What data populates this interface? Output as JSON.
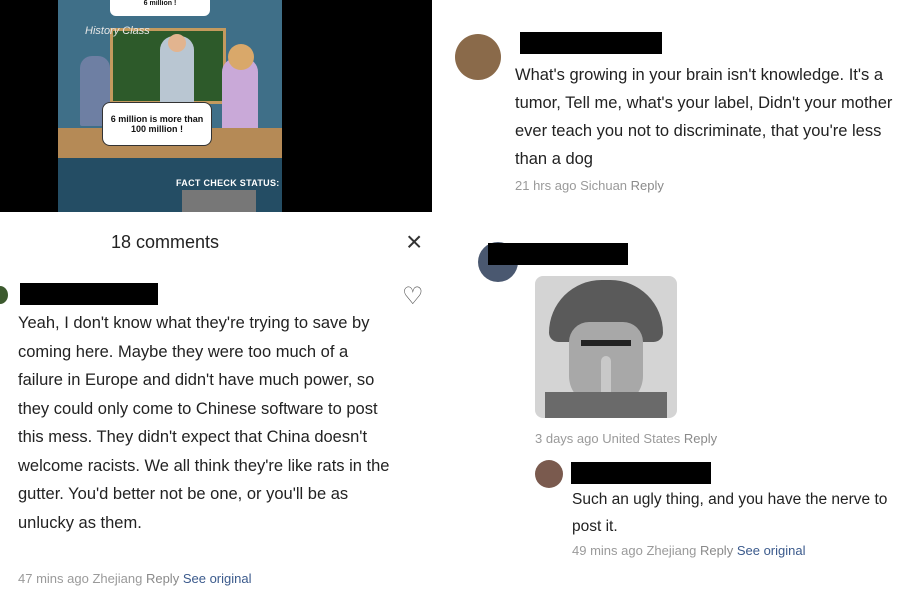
{
  "meme": {
    "top_text": "6 million !",
    "board_label": "History Class",
    "bubble_text": "6 million is more than 100 million !",
    "fact_check": "FACT CHECK STATUS:"
  },
  "left_panel": {
    "comments_title": "18 comments",
    "close_icon": "×",
    "heart_icon": "♡",
    "comment": {
      "text": "Yeah, I don't know what they're trying to save by coming here. Maybe they were too much of a failure in Europe and didn't have much power, so they could only come to Chinese software to post this mess. They didn't expect that China doesn't welcome racists. We all think they're like rats in the gutter. You'd better not be one, or you'll be as unlucky as them.",
      "time": "47 mins ago",
      "location": "Zhejiang",
      "reply": "Reply",
      "see_original": "See original"
    }
  },
  "right_panel": {
    "comment1": {
      "text": "What's growing in your brain isn't knowledge. It's a tumor, Tell me, what's your label, Didn't your mother ever teach you not to discriminate, that you're less than a dog",
      "time": "21 hrs ago",
      "location": "Sichuan",
      "reply": "Reply"
    },
    "comment2": {
      "time": "3 days ago",
      "location": "United States",
      "reply": "Reply"
    },
    "comment3": {
      "text": "Such an ugly thing, and you have the nerve to post it.",
      "time": "49 mins ago",
      "location": "Zhejiang",
      "reply": "Reply",
      "see_original": "See original"
    }
  }
}
